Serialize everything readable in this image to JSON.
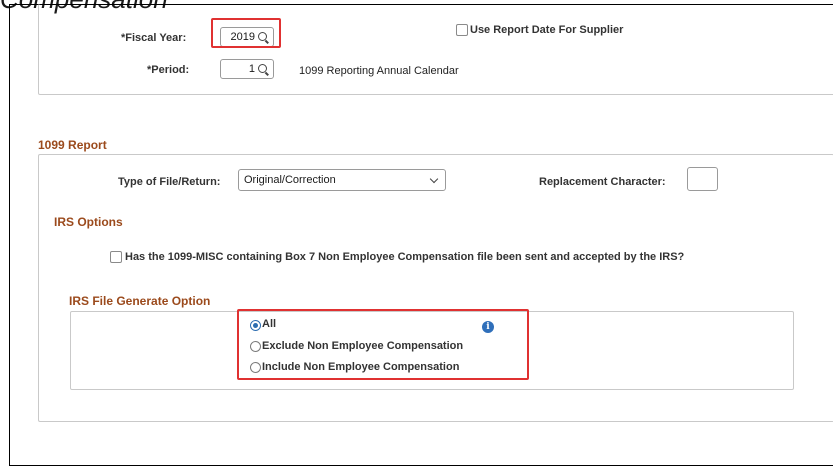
{
  "header": {
    "partial_title": "Compensation"
  },
  "criteria": {
    "fiscal_year_label": "*Fiscal Year:",
    "fiscal_year_value": "2019",
    "period_label": "*Period:",
    "period_value": "1",
    "calendar_text": "1099 Reporting Annual Calendar",
    "use_report_date_label": "Use Report Date For Supplier"
  },
  "report": {
    "section_title": "1099 Report",
    "file_type_label": "Type of File/Return:",
    "file_type_value": "Original/Correction",
    "replacement_label": "Replacement Character:",
    "replacement_value": ""
  },
  "irs": {
    "section_title": "IRS Options",
    "misc_question": "Has the 1099-MISC containing Box 7 Non Employee Compensation file been sent and accepted by the IRS?",
    "generate_title": "IRS File Generate Option",
    "options": [
      {
        "label": "All",
        "selected": true
      },
      {
        "label": "Exclude Non Employee Compensation",
        "selected": false
      },
      {
        "label": "Include Non Employee Compensation",
        "selected": false
      }
    ],
    "info_icon": "i"
  },
  "colors": {
    "highlight": "#e03131",
    "section_text": "#9b4a1c",
    "radio_accent": "#2b6cb0",
    "info_icon": "#2f6fba"
  }
}
